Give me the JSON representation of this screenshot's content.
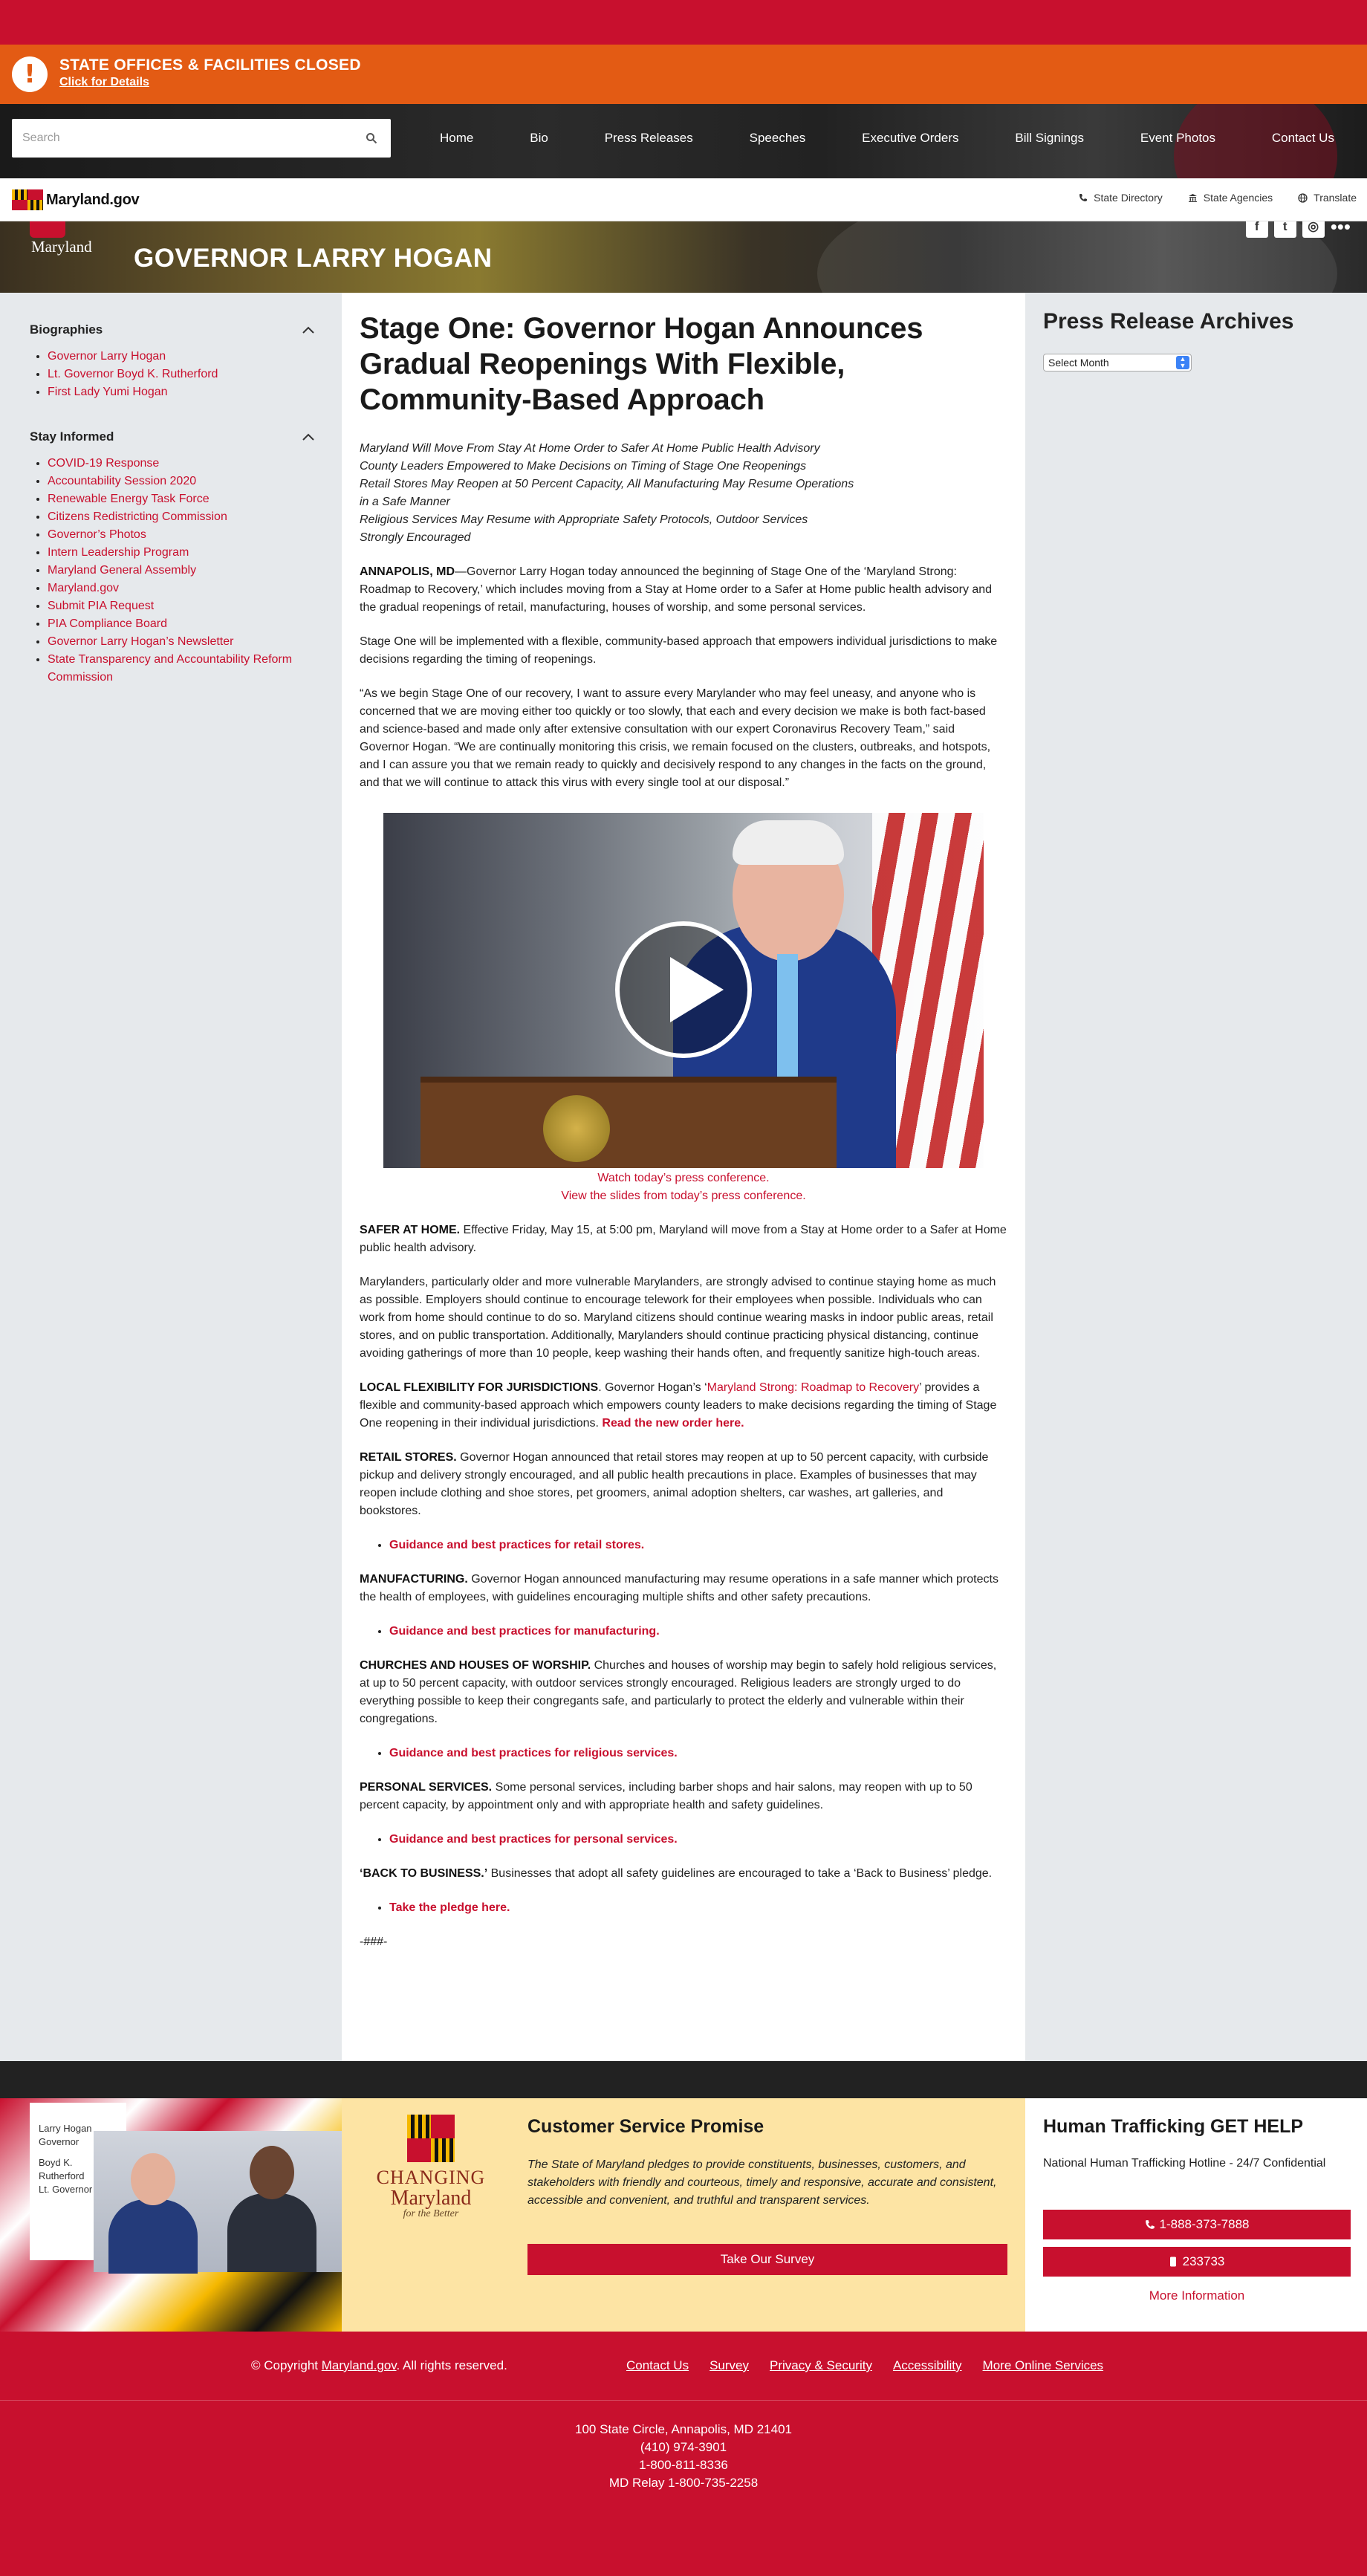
{
  "alert": {
    "title": "STATE OFFICES & FACILITIES CLOSED",
    "link": "Click for Details",
    "icon": "exclamation-icon"
  },
  "search": {
    "placeholder": "Search"
  },
  "nav": {
    "items": [
      "Home",
      "Bio",
      "Press Releases",
      "Speeches",
      "Executive Orders",
      "Bill Signings",
      "Event Photos",
      "Contact Us"
    ]
  },
  "mdbar": {
    "logo_text": "Maryland.gov",
    "links": [
      "State Directory",
      "State Agencies",
      "Translate"
    ]
  },
  "banner": {
    "state": "Maryland",
    "title": "GOVERNOR LARRY HOGAN",
    "social": [
      "facebook-icon",
      "twitter-icon",
      "instagram-icon",
      "more-icon"
    ]
  },
  "sidebar": {
    "biographies": {
      "heading": "Biographies",
      "items": [
        "Governor Larry Hogan",
        "Lt. Governor Boyd K. Rutherford",
        "First Lady Yumi Hogan"
      ]
    },
    "stay_informed": {
      "heading": "Stay Informed",
      "items": [
        "COVID-19 Response",
        "Accountability Session 2020",
        "Renewable Energy Task Force",
        "Citizens Redistricting Commission",
        "Governor’s Photos",
        "Intern Leadership Program",
        "Maryland General Assembly",
        "Maryland.gov",
        "Submit PIA Request",
        "PIA Compliance Board",
        "Governor Larry Hogan’s Newsletter",
        "State Transparency and Accountability Reform Commission"
      ]
    }
  },
  "archives": {
    "title": "Press Release Archives",
    "select_value": "Select Month"
  },
  "article": {
    "title": "Stage One: Governor Hogan Announces Gradual Reopenings With Flexible, Community-Based Approach",
    "subheads": [
      "Maryland Will Move From Stay At Home Order to Safer At Home Public Health Advisory",
      "County Leaders Empowered to Make Decisions on Timing of Stage One Reopenings",
      "Retail Stores May Reopen at 50 Percent Capacity, All Manufacturing May Resume Operations",
      "in a Safe Manner",
      "Religious Services May Resume with Appropriate Safety Protocols, Outdoor Services",
      "Strongly Encouraged"
    ],
    "p1_lead": "ANNAPOLIS, MD",
    "p1": "—Governor Larry Hogan today announced the beginning of Stage One of the ‘Maryland Strong: Roadmap to Recovery,’ which includes moving from a Stay at Home order to a Safer at Home public health advisory and the gradual reopenings of retail, manufacturing, houses of worship, and some personal services.",
    "p2": "Stage One will be implemented with a flexible, community-based approach that empowers individual jurisdictions to make decisions regarding the timing of reopenings.",
    "p3": "“As we begin Stage One of our recovery, I want to assure every Marylander who may feel uneasy, and anyone who is concerned that we are moving either too quickly or too slowly, that each and every decision we make is both fact-based and science-based and made only after extensive consultation with our expert Coronavirus Recovery Team,” said Governor Hogan. “We are continually monitoring this crisis, we remain focused on the clusters, outbreaks, and hotspots, and I can assure you that we remain ready to quickly and decisively respond to any changes in the facts on the ground, and that we will continue to attack this virus with every single tool at our disposal.”",
    "video_cap1": "Watch today’s press conference.",
    "video_cap2": "View the slides from today’s press conference.",
    "safer_lead": "SAFER AT HOME.",
    "safer": " Effective Friday, May 15, at 5:00 pm, Maryland will move from a Stay at Home order to a Safer at Home public health advisory.",
    "p5": "Marylanders, particularly older and more vulnerable Marylanders, are strongly advised to continue staying home as much as possible. Employers should continue to encourage telework for their employees when possible. Individuals who can work from home should continue to do so. Maryland citizens should continue wearing masks in indoor public areas, retail stores, and on public transportation. Additionally, Marylanders should continue practicing physical distancing, continue avoiding gatherings of more than 10 people, keep washing their hands often, and frequently sanitize high-touch areas.",
    "local_lead": "LOCAL FLEXIBILITY FOR JURISDICTIONS",
    "local_a": ". Governor Hogan’s ‘",
    "local_link": "Maryland Strong: Roadmap to Recovery",
    "local_b": "’ provides a flexible and community-based approach which empowers county leaders to make decisions regarding the timing of Stage One reopening in their individual jurisdictions. ",
    "local_order": "Read the new order here.",
    "retail_lead": "RETAIL STORES.",
    "retail": " Governor Hogan announced that retail stores may reopen at up to 50 percent capacity, with curbside pickup and delivery strongly encouraged, and all public health precautions in place. Examples of businesses that may reopen include clothing and shoe stores, pet groomers, animal adoption shelters, car washes, art galleries, and bookstores.",
    "retail_link": "Guidance and best practices for retail stores.",
    "mfg_lead": "MANUFACTURING.",
    "mfg": " Governor Hogan announced manufacturing may resume operations in a safe manner which protects the health of employees, with guidelines encouraging multiple shifts and other safety precautions.",
    "mfg_link": "Guidance and best practices for manufacturing.",
    "church_lead": "CHURCHES AND HOUSES OF WORSHIP.",
    "church": " Churches and houses of worship may begin to safely hold religious services, at up to 50 percent capacity, with outdoor services strongly encouraged. Religious leaders are strongly urged to do everything possible to keep their congregants safe, and particularly to protect the elderly and vulnerable within their congregations.",
    "church_link": "Guidance and best practices for religious services.",
    "personal_lead": "PERSONAL SERVICES.",
    "personal": " Some personal services, including barber shops and hair salons, may reopen with up to 50 percent capacity, by appointment only and with appropriate health and safety guidelines.",
    "personal_link": "Guidance and best practices for personal services.",
    "btb_lead": "‘BACK TO BUSINESS.’",
    "btb": " Businesses that adopt all safety guidelines are encouraged to take a ‘Back to Business’ pledge.",
    "btb_link": "Take the pledge here.",
    "end": "-###-"
  },
  "promo": {
    "card_line1": "Larry Hogan",
    "card_line2": "Governor",
    "card_line3": "Boyd K. Rutherford",
    "card_line4": "Lt. Governor",
    "cm_line1": "CHANGING",
    "cm_line2": "Maryland",
    "cm_line3": "for the Better",
    "csp_title": "Customer Service Promise",
    "csp_text": "The State of Maryland pledges to provide constituents, businesses, customers, and stakeholders with friendly and courteous, timely and responsive, accurate and consistent, accessible and convenient, and truthful and transparent services.",
    "survey_button": "Take Our Survey",
    "ht_title": "Human Trafficking GET HELP",
    "ht_text": "National Human Trafficking Hotline - 24/7 Confidential",
    "ht_phone": "1-888-373-7888",
    "ht_sms": "233733",
    "ht_more": "More Information"
  },
  "footer": {
    "copy_pre": "© Copyright ",
    "copy_link": "Maryland.gov",
    "copy_post": ". All rights reserved.",
    "links": [
      "Contact Us",
      "Survey",
      "Privacy & Security",
      "Accessibility",
      "More Online Services"
    ],
    "address": [
      "100 State Circle, Annapolis, MD 21401",
      "(410) 974-3901",
      "1-800-811-8336",
      "MD Relay 1-800-735-2258"
    ]
  }
}
